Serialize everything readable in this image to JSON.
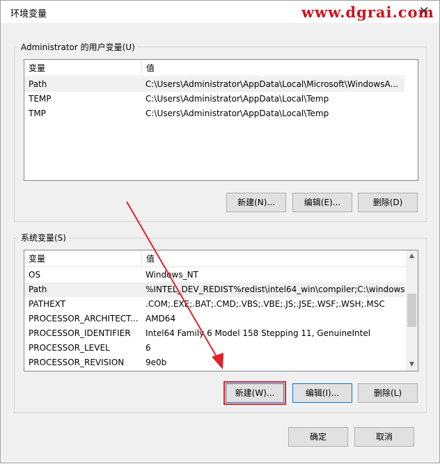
{
  "window": {
    "title": "环境变量",
    "watermark": "www.dgrai.com",
    "close_glyph": "✕"
  },
  "user_vars": {
    "legend": "Administrator 的用户变量(U)",
    "columns": [
      "变量",
      "值"
    ],
    "rows": [
      {
        "name": "Path",
        "value": "C:\\Users\\Administrator\\AppData\\Local\\Microsoft\\WindowsA..."
      },
      {
        "name": "TEMP",
        "value": "C:\\Users\\Administrator\\AppData\\Local\\Temp"
      },
      {
        "name": "TMP",
        "value": "C:\\Users\\Administrator\\AppData\\Local\\Temp"
      }
    ],
    "buttons": {
      "new": "新建(N)...",
      "edit": "编辑(E)...",
      "delete": "删除(D)"
    }
  },
  "system_vars": {
    "legend": "系统变量(S)",
    "columns": [
      "变量",
      "值"
    ],
    "rows": [
      {
        "name": "OS",
        "value": "Windows_NT"
      },
      {
        "name": "Path",
        "value": "%INTEL_DEV_REDIST%redist\\intel64_win\\compiler;C:\\windows..."
      },
      {
        "name": "PATHEXT",
        "value": ".COM;.EXE;.BAT;.CMD;.VBS;.VBE;.JS;.JSE;.WSF;.WSH;.MSC"
      },
      {
        "name": "PROCESSOR_ARCHITECT...",
        "value": "AMD64"
      },
      {
        "name": "PROCESSOR_IDENTIFIER",
        "value": "Intel64 Family 6 Model 158 Stepping 11, GenuineIntel"
      },
      {
        "name": "PROCESSOR_LEVEL",
        "value": "6"
      },
      {
        "name": "PROCESSOR_REVISION",
        "value": "9e0b"
      }
    ],
    "buttons": {
      "new": "新建(W)...",
      "edit": "编辑(I)...",
      "delete": "删除(L)"
    }
  },
  "footer": {
    "ok": "确定",
    "cancel": "取消"
  },
  "colors": {
    "annotation_red": "#e0222b",
    "focus_blue": "#0078d7",
    "watermark_red": "#d0121b"
  }
}
